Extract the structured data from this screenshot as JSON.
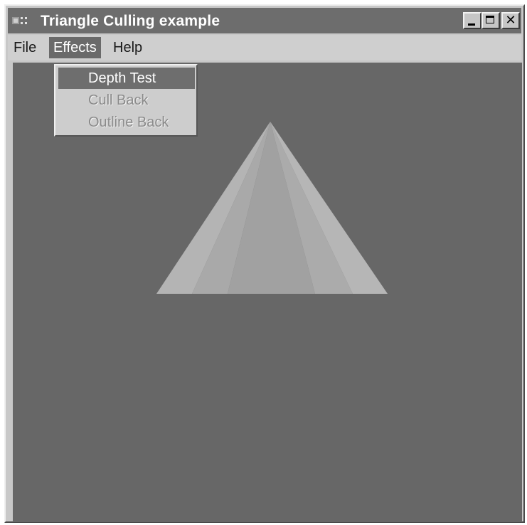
{
  "window": {
    "title": "Triangle Culling example"
  },
  "titlebar": {
    "icons": [
      "app-icon",
      "minimize-icon",
      "maximize-icon",
      "close-icon"
    ]
  },
  "menubar": {
    "items": [
      {
        "label": "File"
      },
      {
        "label": "Effects",
        "open": true
      },
      {
        "label": "Help"
      }
    ]
  },
  "effects_menu": {
    "items": [
      {
        "label": "Depth Test",
        "highlighted": true
      },
      {
        "label": "Cull Back",
        "enabled": false
      },
      {
        "label": "Outline Back",
        "enabled": false
      }
    ]
  },
  "colors": {
    "title_bar": "#6d6d6d",
    "viewport_bg": "#676767",
    "menu_highlight": "#6e6e6e",
    "pyramid_faces": [
      "#b4b4b4",
      "#a9a9a9",
      "#a0a0a0",
      "#a9a9a9",
      "#b4b4b4"
    ]
  }
}
